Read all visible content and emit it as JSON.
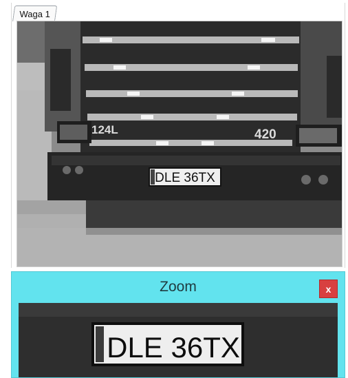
{
  "tabs": [
    {
      "label": "Waga 1",
      "active": true
    }
  ],
  "camera": {
    "grill_badge_left": "124L",
    "grill_badge_right": "420",
    "plate_text": "DLE 36TX"
  },
  "zoom": {
    "title": "Zoom",
    "close_label": "x",
    "plate_text": "DLE 36TX"
  },
  "colors": {
    "zoom_bar": "#62e3ee",
    "close_button": "#d84040"
  }
}
